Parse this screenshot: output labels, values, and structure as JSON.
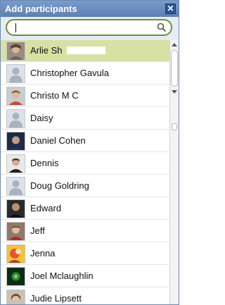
{
  "dialog": {
    "title": "Add participants",
    "close_label": "✕"
  },
  "search": {
    "value": "",
    "placeholder": ""
  },
  "colors": {
    "title_bar": "#5d7fb2",
    "selected_row": "#d7e1a4",
    "search_border": "#6d8f3a"
  },
  "participants": [
    {
      "name": "Arlie Sh",
      "avatar": "photo",
      "selected": true
    },
    {
      "name": "Christopher Gavula",
      "avatar": "placeholder-person-icon",
      "selected": false
    },
    {
      "name": "Christo M C",
      "avatar": "photo",
      "selected": false
    },
    {
      "name": "Daisy",
      "avatar": "placeholder-person-icon",
      "selected": false
    },
    {
      "name": "Daniel Cohen",
      "avatar": "photo",
      "selected": false
    },
    {
      "name": "Dennis",
      "avatar": "photo",
      "selected": false
    },
    {
      "name": "Doug Goldring",
      "avatar": "placeholder-person-icon",
      "selected": false
    },
    {
      "name": "Edward",
      "avatar": "photo",
      "selected": false
    },
    {
      "name": "Jeff",
      "avatar": "photo",
      "selected": false
    },
    {
      "name": "Jenna",
      "avatar": "photo",
      "selected": false
    },
    {
      "name": "Joel Mclaughlin",
      "avatar": "photo",
      "selected": false
    },
    {
      "name": "Judie Lipsett",
      "avatar": "photo",
      "selected": false
    }
  ]
}
